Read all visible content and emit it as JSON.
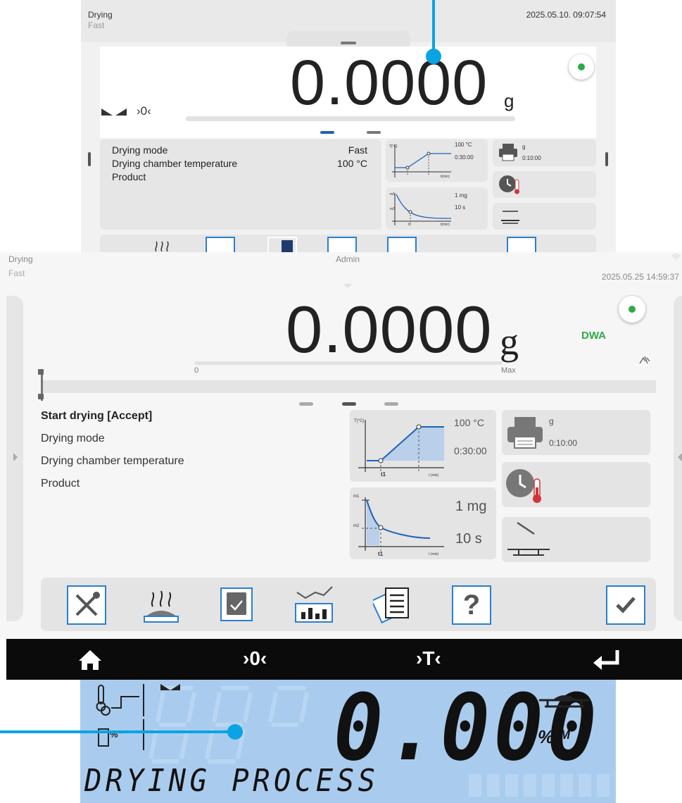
{
  "top": {
    "title": "Drying",
    "subtitle": "Fast",
    "datetime": "2025.05.10.  09:07:54",
    "reading": "0.0000",
    "unit": "g",
    "zero_icon_text": "›0‹",
    "info": [
      {
        "label": "Drying mode",
        "value": "Fast"
      },
      {
        "label": "Drying chamber temperature",
        "value": "100 °C"
      },
      {
        "label": "Product",
        "value": ""
      }
    ],
    "chart_temp": {
      "y_axis": "T[°C]",
      "x_axis": "t(min)",
      "temp": "100 °C",
      "time": "0:30:00"
    },
    "chart_mass": {
      "m1": "m1",
      "m2": "m2",
      "t1": "t1",
      "x_axis": "t(min)",
      "mass": "1 mg",
      "time": "10 s"
    },
    "printout": {
      "unit": "g",
      "interval": "0:10:00"
    }
  },
  "mid": {
    "title": "Drying",
    "subtitle": "Fast",
    "user": "Admin",
    "datetime": "2025.05.25 14:59:37",
    "reading": "0.0000",
    "unit": "g",
    "dwa": "DWA",
    "bar_min": "0",
    "bar_max": "Max",
    "list": [
      "Start drying [Accept]",
      "Drying mode",
      "Drying chamber temperature",
      "Product"
    ],
    "chart_temp": {
      "y_axis": "T(°C)",
      "x_axis": "t (min)",
      "t1": "t1",
      "temp": "100 °C",
      "time": "0:30:00"
    },
    "chart_mass": {
      "m1": "m1",
      "m2": "m2",
      "t1": "t1",
      "x_axis": "t (min)",
      "mass": "1 mg",
      "time": "10 s"
    },
    "printout": {
      "unit": "g",
      "interval": "0:10:00"
    },
    "help_label": "?"
  },
  "nav": {
    "zero_label": "›0‹",
    "tare_label": "›T‹"
  },
  "lcd": {
    "reading": "0.000",
    "unit": "% ᴹ",
    "message": "DRYING PROCESS",
    "pct_label": "%\""
  },
  "colors": {
    "accent_blue": "#2a7fd0",
    "callout": "#0aa3e3",
    "stable_green": "#2daa4a",
    "dwa_green": "#2daa4a",
    "lcd_bg": "#a9ccee"
  }
}
